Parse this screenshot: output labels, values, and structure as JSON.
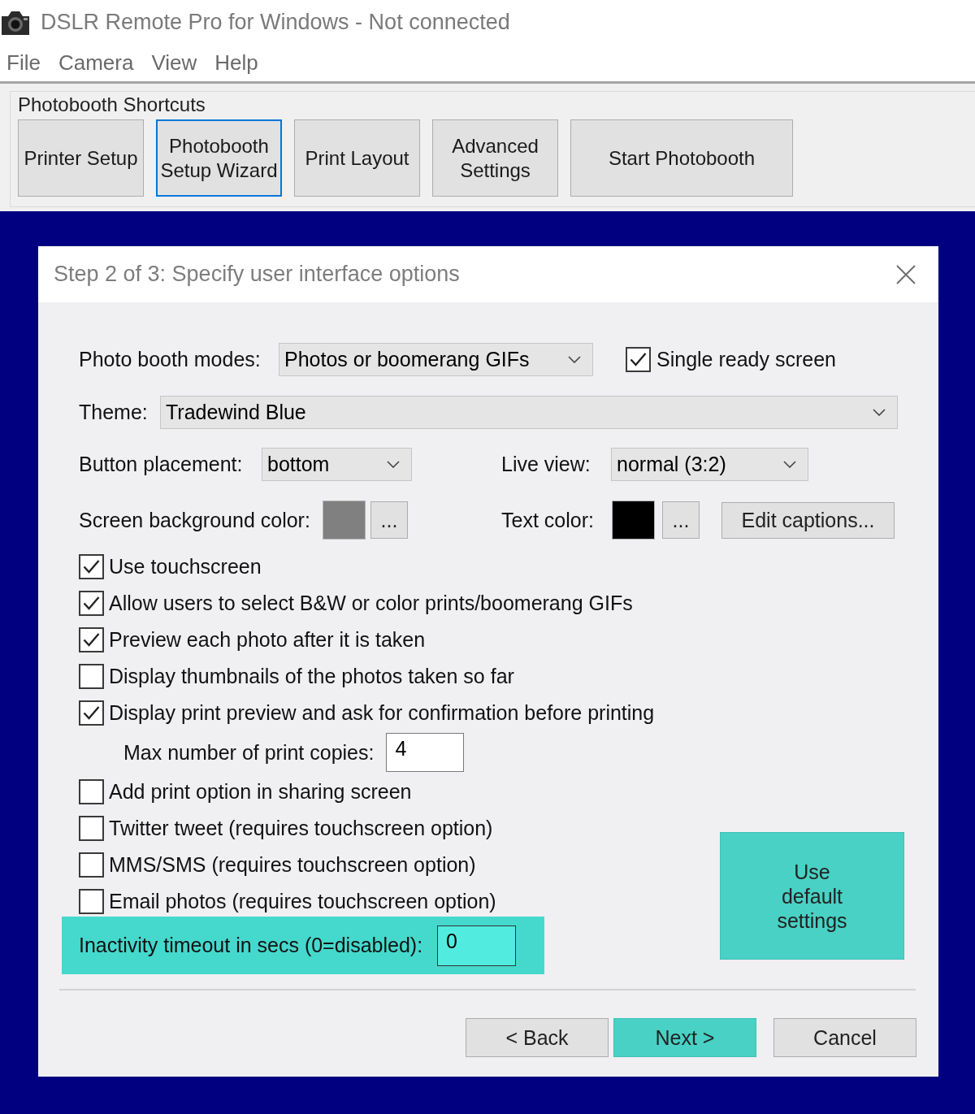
{
  "window": {
    "title": "DSLR Remote Pro for Windows - Not connected"
  },
  "menu": [
    "File",
    "Camera",
    "View",
    "Help"
  ],
  "shortcuts": {
    "title": "Photobooth Shortcuts",
    "buttons": [
      {
        "label": "Printer Setup",
        "selected": false
      },
      {
        "label": "Photobooth Setup Wizard",
        "selected": true
      },
      {
        "label": "Print Layout",
        "selected": false
      },
      {
        "label": "Advanced Settings",
        "selected": false
      },
      {
        "label": "Start Photobooth",
        "selected": false
      }
    ]
  },
  "dialog": {
    "title": "Step 2 of 3: Specify user interface options",
    "modes": {
      "label": "Photo booth modes:",
      "value": "Photos or boomerang GIFs"
    },
    "single_ready": {
      "label": "Single ready screen",
      "checked": true
    },
    "theme": {
      "label": "Theme:",
      "value": "Tradewind Blue"
    },
    "button_placement": {
      "label": "Button placement:",
      "value": "bottom"
    },
    "live_view": {
      "label": "Live view:",
      "value": "normal (3:2)"
    },
    "background_color": {
      "label": "Screen background color:",
      "color": "#808080",
      "button": "..."
    },
    "text_color": {
      "label": "Text color:",
      "color": "#000000",
      "button": "..."
    },
    "edit_captions": "Edit captions...",
    "options": [
      {
        "kind": "checkbox",
        "label": "Use touchscreen",
        "checked": true
      },
      {
        "kind": "checkbox",
        "label": "Allow users to select B&W or color prints/boomerang GIFs",
        "checked": true
      },
      {
        "kind": "checkbox",
        "label": "Preview each photo after it is taken",
        "checked": true
      },
      {
        "kind": "checkbox",
        "label": "Display thumbnails of the photos taken so far",
        "checked": false
      },
      {
        "kind": "checkbox",
        "label": "Display print preview and ask for confirmation before printing",
        "checked": true
      },
      {
        "kind": "number",
        "label": "Max number of print copies:",
        "value": "4"
      },
      {
        "kind": "checkbox",
        "label": "Add print option in sharing screen",
        "checked": false
      },
      {
        "kind": "checkbox",
        "label": "Twitter tweet (requires touchscreen option)",
        "checked": false
      },
      {
        "kind": "checkbox",
        "label": "MMS/SMS (requires touchscreen option)",
        "checked": false
      },
      {
        "kind": "checkbox",
        "label": "Email photos (requires touchscreen option)",
        "checked": false
      }
    ],
    "timeout": {
      "label": "Inactivity timeout in secs (0=disabled):",
      "value": "0",
      "highlighted": true
    },
    "default_button": {
      "label": "Use default settings",
      "highlighted": true
    },
    "nav_buttons": [
      {
        "label": "< Back",
        "highlighted": false
      },
      {
        "label": "Next >",
        "highlighted": true
      },
      {
        "label": "Cancel",
        "highlighted": false
      }
    ]
  }
}
